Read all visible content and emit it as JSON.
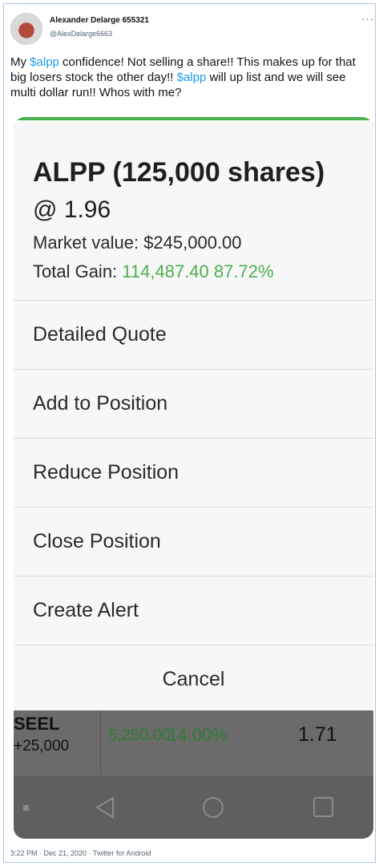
{
  "tweet": {
    "author_name": "Alexander Delarge 655321",
    "author_handle": "@AlexDelarge6663",
    "more_glyph": "···",
    "text_parts": [
      {
        "text": "My ",
        "type": "plain"
      },
      {
        "text": "$alpp",
        "type": "cashtag"
      },
      {
        "text": " confidence! Not selling a share!! This makes up for that big losers stock the other day!! ",
        "type": "plain"
      },
      {
        "text": "$alpp",
        "type": "cashtag"
      },
      {
        "text": " will up list and we will see multi dollar run!! Whos with me?",
        "type": "plain"
      }
    ],
    "footer": "3:22 PM · Dec 21, 2020 · Twitter for Android",
    "colors": {
      "cashtag": "#1d9bf0",
      "muted": "#536471"
    }
  },
  "screenshot": {
    "position": {
      "title": "ALPP (125,000 shares)",
      "price": "@ 1.96",
      "market_value_label": "Market value:",
      "market_value": "$245,000.00",
      "total_gain_label": "Total Gain:",
      "total_gain_value": "114,487.40",
      "total_gain_pct": "87.72%"
    },
    "menu": [
      {
        "label": "Detailed Quote"
      },
      {
        "label": "Add to Position"
      },
      {
        "label": "Reduce Position"
      },
      {
        "label": "Close Position"
      },
      {
        "label": "Create Alert"
      }
    ],
    "cancel_label": "Cancel",
    "background_row": {
      "ticker": "SEEL",
      "quantity": "+25,000",
      "gain_value": "5,250.00",
      "gain_pct": "14.00%",
      "last_price": "1.71"
    },
    "navbar": {
      "icons": [
        "square-dot-icon",
        "back-triangle-icon",
        "home-circle-icon",
        "recents-square-icon"
      ]
    },
    "colors": {
      "accent_green": "#4caf50",
      "sheet_bg": "#f7f7f7",
      "overlay": "#6b6b6b"
    }
  }
}
